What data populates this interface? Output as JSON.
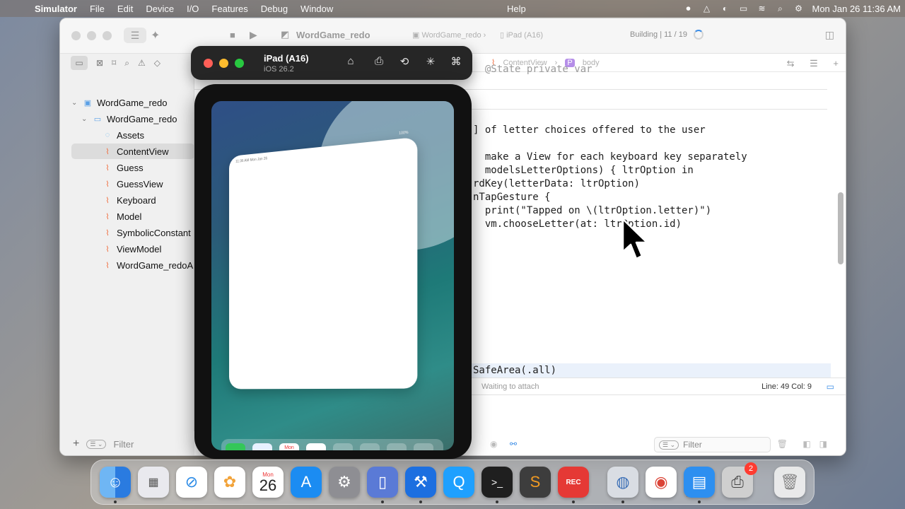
{
  "menubar": {
    "app_name": "Simulator",
    "menus": [
      "File",
      "Edit",
      "Device",
      "I/O",
      "Features",
      "Debug",
      "Window"
    ],
    "help": "Help",
    "clock": "Mon Jan 26  11:36 AM"
  },
  "xcode": {
    "project_name": "WordGame_redo",
    "scheme": "WordGame_redo",
    "run_destination": "iPad (A16)",
    "build_status": "Building | 11 / 19",
    "jumpbar": [
      "ContentView",
      "body"
    ],
    "jumpbar_badge": "P",
    "navigator": {
      "items": [
        {
          "label": "WordGame_redo",
          "level": 0,
          "kind": "project"
        },
        {
          "label": "WordGame_redo",
          "level": 1,
          "kind": "folder"
        },
        {
          "label": "Assets",
          "level": 2,
          "kind": "assets"
        },
        {
          "label": "ContentView",
          "level": 2,
          "kind": "swift",
          "selected": true
        },
        {
          "label": "Guess",
          "level": 2,
          "kind": "swift"
        },
        {
          "label": "GuessView",
          "level": 2,
          "kind": "swift"
        },
        {
          "label": "Keyboard",
          "level": 2,
          "kind": "swift"
        },
        {
          "label": "Model",
          "level": 2,
          "kind": "swift"
        },
        {
          "label": "SymbolicConstant",
          "level": 2,
          "kind": "swift"
        },
        {
          "label": "ViewModel",
          "level": 2,
          "kind": "swift"
        },
        {
          "label": "WordGame_redoA",
          "level": 2,
          "kind": "swift"
        }
      ],
      "filter_placeholder": "Filter"
    },
    "code_lines": [
      {
        "text": "  @State private var",
        "dim": true
      },
      {
        "text": "] of letter choices offered to the user"
      },
      {
        "text": "  make a View for each keyboard key separately"
      },
      {
        "text": "  modelsLetterOptions) { ltrOption in"
      },
      {
        "text": "rdKey(letterData: ltrOption)"
      },
      {
        "text": "nTapGesture {"
      },
      {
        "text": "  print(\"Tapped on \\(ltrOption.letter)\")"
      },
      {
        "text": "  vm.chooseLetter(at: ltrOption.id)"
      },
      {
        "text": "SafeArea(.all)"
      }
    ],
    "debug_status": "Waiting to attach",
    "line_col": "Line: 49  Col: 9",
    "console_filter_placeholder": "Filter"
  },
  "simulator": {
    "device_name": "iPad (A16)",
    "os_version": "iOS 26.2",
    "app_status_time": "11:36 AM   Mon Jan 26",
    "battery": "100%"
  },
  "dock": {
    "calendar_month": "Mon",
    "calendar_day": "26",
    "rec_label": "REC",
    "printer_badge": "2",
    "apps": [
      "Finder",
      "Launchpad",
      "Safari",
      "Photos",
      "Calendar",
      "App Store",
      "System Settings",
      "Simulator",
      "Xcode",
      "QuickTime",
      "Terminal",
      "Sublime Text",
      "Screen Recorder",
      "Disk Utility",
      "Chrome",
      "Files",
      "Printer",
      "Trash"
    ]
  }
}
